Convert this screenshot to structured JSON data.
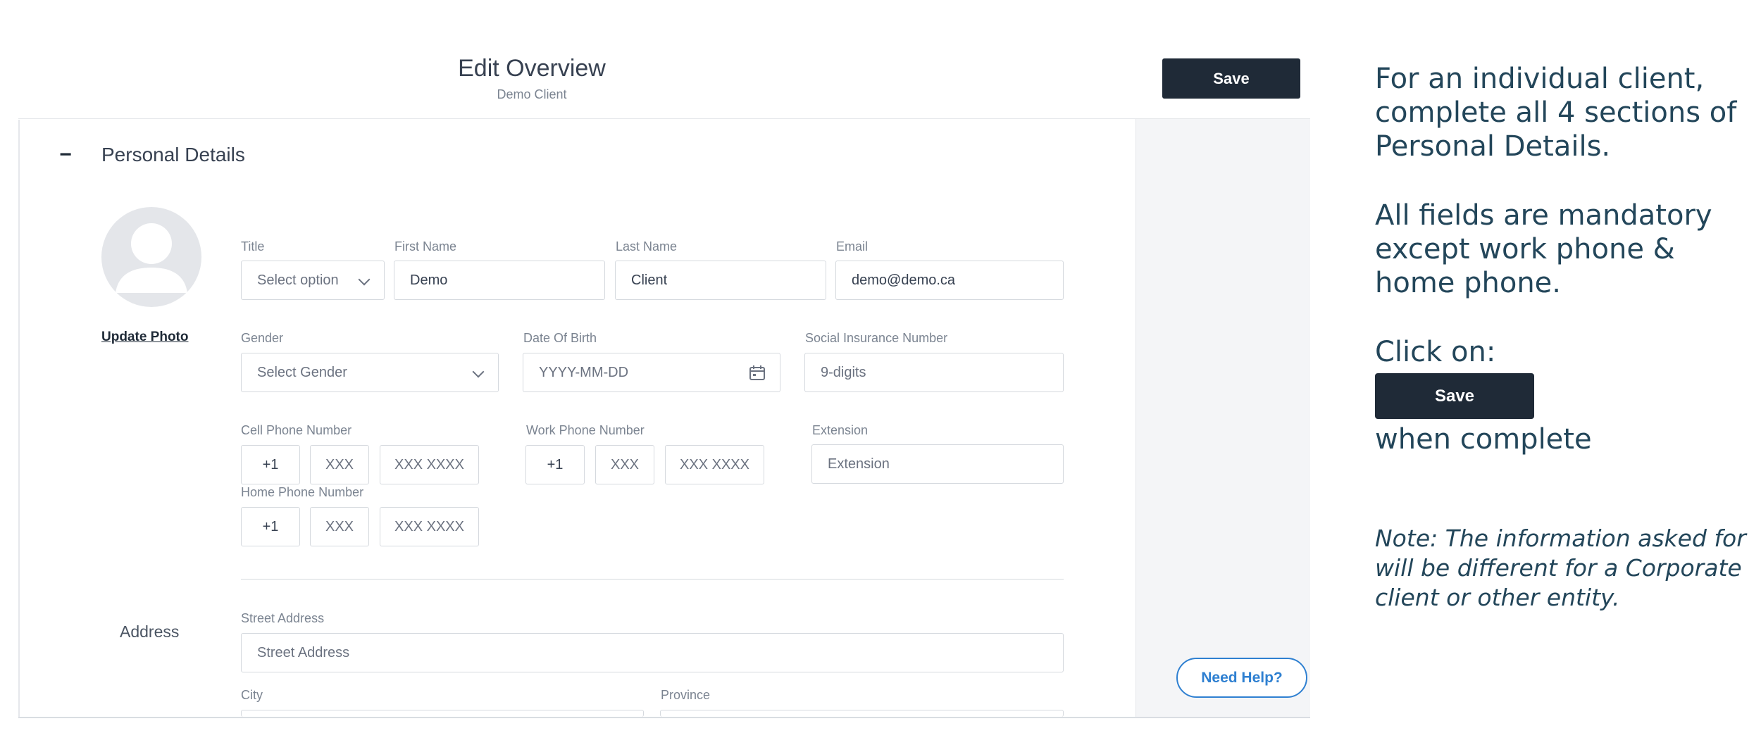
{
  "header": {
    "title": "Edit Overview",
    "subtitle": "Demo Client",
    "save_label": "Save"
  },
  "section": {
    "toggle": "−",
    "title": "Personal Details",
    "update_photo": "Update Photo"
  },
  "fields": {
    "title": {
      "label": "Title",
      "value": "Select option"
    },
    "first_name": {
      "label": "First Name",
      "value": "Demo"
    },
    "last_name": {
      "label": "Last Name",
      "value": "Client"
    },
    "email": {
      "label": "Email",
      "value": "demo@demo.ca"
    },
    "gender": {
      "label": "Gender",
      "value": "Select Gender"
    },
    "dob": {
      "label": "Date Of Birth",
      "placeholder": "YYYY-MM-DD"
    },
    "sin": {
      "label": "Social Insurance Number",
      "placeholder": "9-digits"
    },
    "cell_phone": {
      "label": "Cell Phone Number",
      "country": "+1",
      "area": "XXX",
      "number": "XXX XXXX"
    },
    "work_phone": {
      "label": "Work Phone Number",
      "country": "+1",
      "area": "XXX",
      "number": "XXX XXXX"
    },
    "extension": {
      "label": "Extension",
      "placeholder": "Extension"
    },
    "home_phone": {
      "label": "Home Phone Number",
      "country": "+1",
      "area": "XXX",
      "number": "XXX XXXX"
    },
    "address": {
      "label": "Address"
    },
    "street": {
      "label": "Street Address",
      "placeholder": "Street Address"
    },
    "city": {
      "label": "City"
    },
    "province": {
      "label": "Province"
    }
  },
  "need_help": "Need Help?",
  "instructions": {
    "p1": "For an individual client, complete all 4 sections of Personal Details.",
    "p2": "All fields are mandatory except work phone & home phone.",
    "p3": "Click on:",
    "save_label": "Save",
    "p4": "when complete",
    "note": "Note: The information asked for will be different for a Corporate client or other entity."
  },
  "colors": {
    "primary_dark": "#1f2a37",
    "help_blue": "#2f80d1",
    "instruction_text": "#23465a"
  },
  "icons": [
    "avatar-placeholder-icon",
    "chevron-down-icon",
    "calendar-icon",
    "collapse-minus-icon"
  ]
}
